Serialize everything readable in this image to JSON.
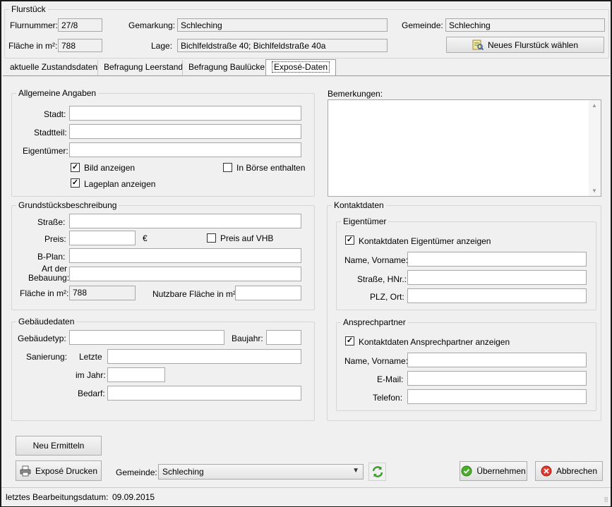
{
  "flurstueck": {
    "group_title": "Flurstück",
    "flurnummer_label": "Flurnummer:",
    "flurnummer_value": "27/8",
    "gemarkung_label": "Gemarkung:",
    "gemarkung_value": "Schleching",
    "gemeinde_label": "Gemeinde:",
    "gemeinde_value": "Schleching",
    "flaeche_label": "Fläche in m²:",
    "flaeche_value": "788",
    "lage_label": "Lage:",
    "lage_value": "Bichlfeldstraße 40; Bichlfeldstraße 40a",
    "new_button": "Neues Flurstück wählen"
  },
  "tabs": [
    "aktuelle Zustandsdaten",
    "Befragung Leerstand",
    "Befragung Baulücke",
    "Exposé-Daten"
  ],
  "allgemein": {
    "title": "Allgemeine Angaben",
    "stadt_label": "Stadt:",
    "stadtteil_label": "Stadtteil:",
    "eigentuemer_label": "Eigentümer:",
    "bild_label": "Bild anzeigen",
    "boerse_label": "In Börse enthalten",
    "lageplan_label": "Lageplan anzeigen"
  },
  "bemerkungen": {
    "label": "Bemerkungen:"
  },
  "grundstueck": {
    "title": "Grundstücksbeschreibung",
    "strasse_label": "Straße:",
    "preis_label": "Preis:",
    "currency": "€",
    "vhb_label": "Preis auf VHB",
    "bplan_label": "B-Plan:",
    "art_label_1": "Art der",
    "art_label_2": "Bebauung:",
    "flaeche_label": "Fläche in m²:",
    "flaeche_value": "788",
    "nutzbar_label": "Nutzbare Fläche in m²:"
  },
  "gebaeude": {
    "title": "Gebäudedaten",
    "typ_label": "Gebäudetyp:",
    "baujahr_label": "Baujahr:",
    "sanierung_label": "Sanierung:",
    "letzte_label": "Letzte",
    "jahr_label": "im Jahr:",
    "bedarf_label": "Bedarf:"
  },
  "kontakt": {
    "title": "Kontaktdaten",
    "eig_title": "Eigentümer",
    "eig_check": "Kontaktdaten Eigentümer anzeigen",
    "name_label": "Name, Vorname:",
    "strasse_label": "Straße, HNr.:",
    "plz_label": "PLZ, Ort:",
    "ap_title": "Ansprechpartner",
    "ap_check": "Kontaktdaten Ansprechpartner anzeigen",
    "ap_name_label": "Name, Vorname:",
    "email_label": "E-Mail:",
    "telefon_label": "Telefon:"
  },
  "bottom": {
    "neu_button": "Neu Ermitteln",
    "druck_button": "Exposé Drucken",
    "gemeinde_label": "Gemeinde:",
    "gemeinde_value": "Schleching",
    "ok_button": "Übernehmen",
    "cancel_button": "Abbrechen"
  },
  "status": {
    "label": "letztes Bearbeitungsdatum:",
    "value": "09.09.2015"
  }
}
